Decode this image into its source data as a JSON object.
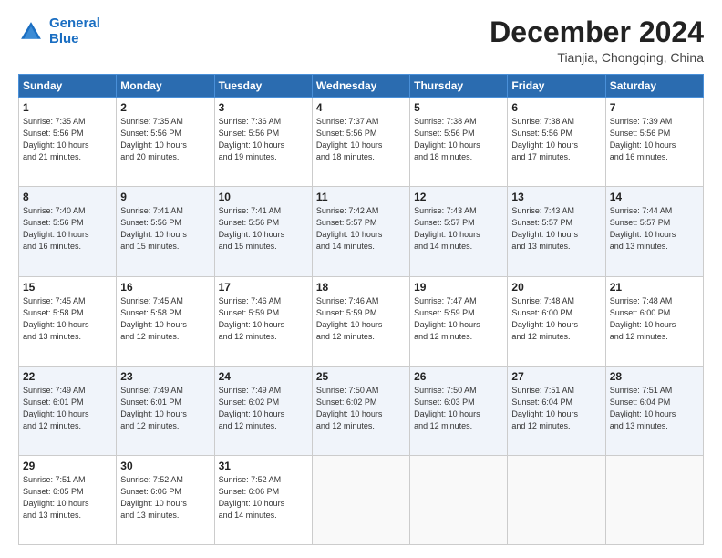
{
  "logo": {
    "line1": "General",
    "line2": "Blue"
  },
  "header": {
    "month": "December 2024",
    "location": "Tianjia, Chongqing, China"
  },
  "weekdays": [
    "Sunday",
    "Monday",
    "Tuesday",
    "Wednesday",
    "Thursday",
    "Friday",
    "Saturday"
  ],
  "weeks": [
    [
      {
        "day": "1",
        "lines": [
          "Sunrise: 7:35 AM",
          "Sunset: 5:56 PM",
          "Daylight: 10 hours",
          "and 21 minutes."
        ]
      },
      {
        "day": "2",
        "lines": [
          "Sunrise: 7:35 AM",
          "Sunset: 5:56 PM",
          "Daylight: 10 hours",
          "and 20 minutes."
        ]
      },
      {
        "day": "3",
        "lines": [
          "Sunrise: 7:36 AM",
          "Sunset: 5:56 PM",
          "Daylight: 10 hours",
          "and 19 minutes."
        ]
      },
      {
        "day": "4",
        "lines": [
          "Sunrise: 7:37 AM",
          "Sunset: 5:56 PM",
          "Daylight: 10 hours",
          "and 18 minutes."
        ]
      },
      {
        "day": "5",
        "lines": [
          "Sunrise: 7:38 AM",
          "Sunset: 5:56 PM",
          "Daylight: 10 hours",
          "and 18 minutes."
        ]
      },
      {
        "day": "6",
        "lines": [
          "Sunrise: 7:38 AM",
          "Sunset: 5:56 PM",
          "Daylight: 10 hours",
          "and 17 minutes."
        ]
      },
      {
        "day": "7",
        "lines": [
          "Sunrise: 7:39 AM",
          "Sunset: 5:56 PM",
          "Daylight: 10 hours",
          "and 16 minutes."
        ]
      }
    ],
    [
      {
        "day": "8",
        "lines": [
          "Sunrise: 7:40 AM",
          "Sunset: 5:56 PM",
          "Daylight: 10 hours",
          "and 16 minutes."
        ]
      },
      {
        "day": "9",
        "lines": [
          "Sunrise: 7:41 AM",
          "Sunset: 5:56 PM",
          "Daylight: 10 hours",
          "and 15 minutes."
        ]
      },
      {
        "day": "10",
        "lines": [
          "Sunrise: 7:41 AM",
          "Sunset: 5:56 PM",
          "Daylight: 10 hours",
          "and 15 minutes."
        ]
      },
      {
        "day": "11",
        "lines": [
          "Sunrise: 7:42 AM",
          "Sunset: 5:57 PM",
          "Daylight: 10 hours",
          "and 14 minutes."
        ]
      },
      {
        "day": "12",
        "lines": [
          "Sunrise: 7:43 AM",
          "Sunset: 5:57 PM",
          "Daylight: 10 hours",
          "and 14 minutes."
        ]
      },
      {
        "day": "13",
        "lines": [
          "Sunrise: 7:43 AM",
          "Sunset: 5:57 PM",
          "Daylight: 10 hours",
          "and 13 minutes."
        ]
      },
      {
        "day": "14",
        "lines": [
          "Sunrise: 7:44 AM",
          "Sunset: 5:57 PM",
          "Daylight: 10 hours",
          "and 13 minutes."
        ]
      }
    ],
    [
      {
        "day": "15",
        "lines": [
          "Sunrise: 7:45 AM",
          "Sunset: 5:58 PM",
          "Daylight: 10 hours",
          "and 13 minutes."
        ]
      },
      {
        "day": "16",
        "lines": [
          "Sunrise: 7:45 AM",
          "Sunset: 5:58 PM",
          "Daylight: 10 hours",
          "and 12 minutes."
        ]
      },
      {
        "day": "17",
        "lines": [
          "Sunrise: 7:46 AM",
          "Sunset: 5:59 PM",
          "Daylight: 10 hours",
          "and 12 minutes."
        ]
      },
      {
        "day": "18",
        "lines": [
          "Sunrise: 7:46 AM",
          "Sunset: 5:59 PM",
          "Daylight: 10 hours",
          "and 12 minutes."
        ]
      },
      {
        "day": "19",
        "lines": [
          "Sunrise: 7:47 AM",
          "Sunset: 5:59 PM",
          "Daylight: 10 hours",
          "and 12 minutes."
        ]
      },
      {
        "day": "20",
        "lines": [
          "Sunrise: 7:48 AM",
          "Sunset: 6:00 PM",
          "Daylight: 10 hours",
          "and 12 minutes."
        ]
      },
      {
        "day": "21",
        "lines": [
          "Sunrise: 7:48 AM",
          "Sunset: 6:00 PM",
          "Daylight: 10 hours",
          "and 12 minutes."
        ]
      }
    ],
    [
      {
        "day": "22",
        "lines": [
          "Sunrise: 7:49 AM",
          "Sunset: 6:01 PM",
          "Daylight: 10 hours",
          "and 12 minutes."
        ]
      },
      {
        "day": "23",
        "lines": [
          "Sunrise: 7:49 AM",
          "Sunset: 6:01 PM",
          "Daylight: 10 hours",
          "and 12 minutes."
        ]
      },
      {
        "day": "24",
        "lines": [
          "Sunrise: 7:49 AM",
          "Sunset: 6:02 PM",
          "Daylight: 10 hours",
          "and 12 minutes."
        ]
      },
      {
        "day": "25",
        "lines": [
          "Sunrise: 7:50 AM",
          "Sunset: 6:02 PM",
          "Daylight: 10 hours",
          "and 12 minutes."
        ]
      },
      {
        "day": "26",
        "lines": [
          "Sunrise: 7:50 AM",
          "Sunset: 6:03 PM",
          "Daylight: 10 hours",
          "and 12 minutes."
        ]
      },
      {
        "day": "27",
        "lines": [
          "Sunrise: 7:51 AM",
          "Sunset: 6:04 PM",
          "Daylight: 10 hours",
          "and 12 minutes."
        ]
      },
      {
        "day": "28",
        "lines": [
          "Sunrise: 7:51 AM",
          "Sunset: 6:04 PM",
          "Daylight: 10 hours",
          "and 13 minutes."
        ]
      }
    ],
    [
      {
        "day": "29",
        "lines": [
          "Sunrise: 7:51 AM",
          "Sunset: 6:05 PM",
          "Daylight: 10 hours",
          "and 13 minutes."
        ]
      },
      {
        "day": "30",
        "lines": [
          "Sunrise: 7:52 AM",
          "Sunset: 6:06 PM",
          "Daylight: 10 hours",
          "and 13 minutes."
        ]
      },
      {
        "day": "31",
        "lines": [
          "Sunrise: 7:52 AM",
          "Sunset: 6:06 PM",
          "Daylight: 10 hours",
          "and 14 minutes."
        ]
      },
      {
        "day": "",
        "lines": []
      },
      {
        "day": "",
        "lines": []
      },
      {
        "day": "",
        "lines": []
      },
      {
        "day": "",
        "lines": []
      }
    ]
  ]
}
